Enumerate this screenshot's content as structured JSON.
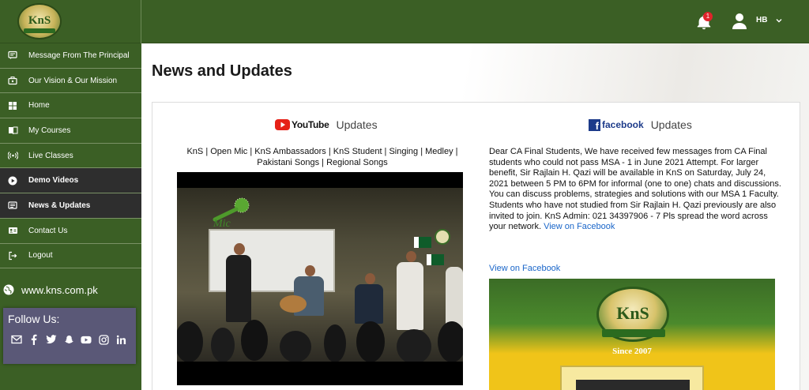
{
  "header": {
    "logo_text": "KnS",
    "notification_count": "1",
    "user_initials": "HB"
  },
  "sidebar": {
    "items": [
      {
        "label": "Message From The Principal",
        "icon": "message-icon"
      },
      {
        "label": "Our Vision & Our Mission",
        "icon": "briefcase-icon"
      },
      {
        "label": "Home",
        "icon": "home-grid-icon"
      },
      {
        "label": "My Courses",
        "icon": "book-icon"
      },
      {
        "label": "Live Classes",
        "icon": "broadcast-icon"
      },
      {
        "label": "Demo Videos",
        "icon": "play-circle-icon"
      },
      {
        "label": "News & Updates",
        "icon": "newspaper-icon"
      },
      {
        "label": "Contact Us",
        "icon": "contact-card-icon"
      },
      {
        "label": "Logout",
        "icon": "logout-icon"
      }
    ],
    "website": "www.kns.com.pk",
    "follow_title": "Follow Us:",
    "social": [
      "email-icon",
      "facebook-icon",
      "twitter-icon",
      "snapchat-icon",
      "youtube-icon",
      "instagram-icon",
      "linkedin-icon"
    ]
  },
  "main": {
    "title": "News and Updates",
    "youtube": {
      "brand": "YouTube",
      "heading": "Updates",
      "video_title": "KnS | Open Mic | KnS Ambassadors | KnS Student | Singing | Medley | Pakistani Songs | Regional Songs",
      "overlay_text": "Mic"
    },
    "facebook": {
      "brand": "facebook",
      "heading": "Updates",
      "post_text": "Dear CA Final Students, We have received few messages from CA Final students who could not pass MSA - 1 in June 2021 Attempt. For larger benefit, Sir Rajlain H. Qazi will be available in KnS on Saturday, July 24, 2021 between 5 PM to 6PM for informal (one to one) chats and discussions. You can discuss problems, strategies and solutions with our MSA 1 Faculty. Students who have not studied from Sir Rajlain H. Qazi previously are also invited to join. KnS Admin: 021 34397906 - 7 Pls spread the word across your network.",
      "inline_link": "View on Facebook",
      "link": "View on Facebook",
      "image_logo": "KnS",
      "image_since": "Since 2007"
    }
  },
  "colors": {
    "sidebar_green": "#3b5f25",
    "active_dark": "#2e2e2e",
    "follow_box": "#5a5877",
    "link_blue": "#1a66c9",
    "badge_red": "#e0242b"
  }
}
